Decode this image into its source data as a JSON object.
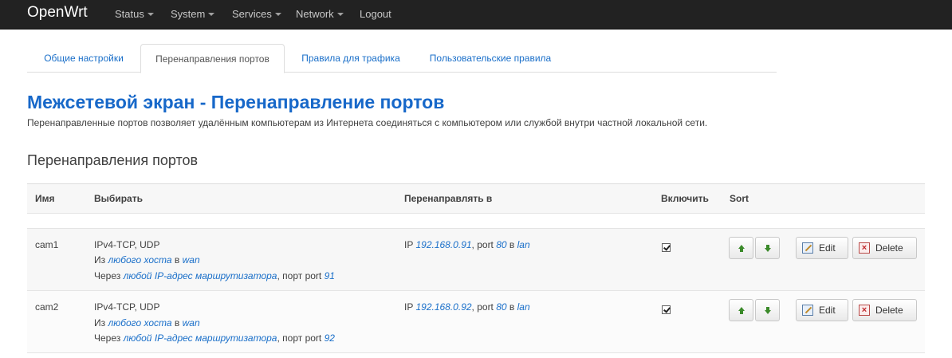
{
  "navbar": {
    "brand": "OpenWrt",
    "items": [
      {
        "label": "Status",
        "has_caret": true
      },
      {
        "label": "System",
        "has_caret": true
      },
      {
        "label": "Services",
        "has_caret": true
      },
      {
        "label": "Network",
        "has_caret": true
      },
      {
        "label": "Logout",
        "has_caret": false
      }
    ]
  },
  "tabs": [
    {
      "label": "Общие настройки",
      "active": false
    },
    {
      "label": "Перенаправления портов",
      "active": true
    },
    {
      "label": "Правила для трафика",
      "active": false
    },
    {
      "label": "Пользовательские правила",
      "active": false
    }
  ],
  "page": {
    "title": "Межсетевой экран - Перенаправление портов",
    "description": "Перенаправленные портов позволяет удалённым компьютерам из Интернета соединяться с компьютером или службой внутри частной локальной сети.",
    "section_title": "Перенаправления портов"
  },
  "table": {
    "headers": {
      "name": "Имя",
      "match": "Выбирать",
      "forward_to": "Перенаправлять в",
      "enable": "Включить",
      "sort": "Sort"
    },
    "rows": [
      {
        "name": "cam1",
        "protocol": "IPv4-TCP, UDP",
        "from_prefix": "Из ",
        "from_host": "любого хоста",
        "from_in": " в ",
        "from_zone": "wan",
        "via_prefix": "Через ",
        "via_addr": "любой IP-адрес маршрутизатора",
        "via_port_text": ", порт port ",
        "via_port": "91",
        "fwd_ip_label": "IP ",
        "fwd_ip": "192.168.0.91",
        "fwd_port_label": ", port ",
        "fwd_port": "80",
        "fwd_in": " в ",
        "fwd_zone": "lan",
        "enabled": true
      },
      {
        "name": "cam2",
        "protocol": "IPv4-TCP, UDP",
        "from_prefix": "Из ",
        "from_host": "любого хоста",
        "from_in": " в ",
        "from_zone": "wan",
        "via_prefix": "Через ",
        "via_addr": "любой IP-адрес маршрутизатора",
        "via_port_text": ", порт port ",
        "via_port": "92",
        "fwd_ip_label": "IP ",
        "fwd_ip": "192.168.0.92",
        "fwd_port_label": ", port ",
        "fwd_port": "80",
        "fwd_in": " в ",
        "fwd_zone": "lan",
        "enabled": true
      }
    ],
    "buttons": {
      "edit": "Edit",
      "delete": "Delete"
    }
  },
  "colors": {
    "navbar_bg": "#222222",
    "link": "#1a6fc9",
    "title": "#1768c9",
    "arrow": "#3b8a2a"
  }
}
